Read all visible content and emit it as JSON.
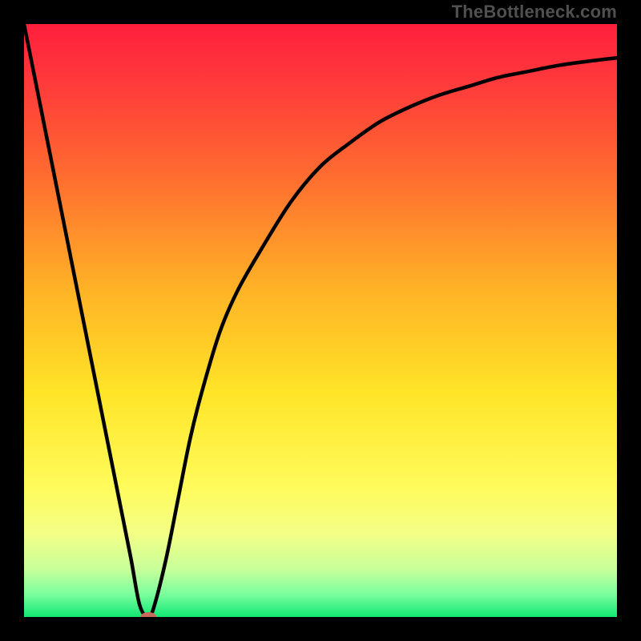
{
  "watermark": "TheBottleneck.com",
  "chart_data": {
    "type": "line",
    "title": "",
    "xlabel": "",
    "ylabel": "",
    "xlim": [
      0,
      100
    ],
    "ylim": [
      0,
      100
    ],
    "axes_visible": false,
    "grid": false,
    "background_gradient_stops": [
      {
        "pos": 0.0,
        "color": "#ff1f3d"
      },
      {
        "pos": 0.1,
        "color": "#ff3a3b"
      },
      {
        "pos": 0.25,
        "color": "#ff6a30"
      },
      {
        "pos": 0.45,
        "color": "#ffb326"
      },
      {
        "pos": 0.62,
        "color": "#ffe427"
      },
      {
        "pos": 0.78,
        "color": "#fffb5b"
      },
      {
        "pos": 0.86,
        "color": "#f3ff86"
      },
      {
        "pos": 0.92,
        "color": "#c7ff9a"
      },
      {
        "pos": 0.96,
        "color": "#7eff9e"
      },
      {
        "pos": 1.0,
        "color": "#11e875"
      }
    ],
    "series": [
      {
        "name": "bottleneck-curve",
        "x": [
          0,
          2,
          4,
          6,
          8,
          10,
          12,
          14,
          16,
          18,
          19.5,
          21,
          22,
          24,
          26,
          28,
          30,
          33,
          36,
          40,
          45,
          50,
          55,
          60,
          65,
          70,
          75,
          80,
          85,
          90,
          95,
          100
        ],
        "y": [
          100,
          90,
          80,
          70,
          60,
          50,
          40,
          30,
          20,
          10,
          2,
          0,
          2,
          10,
          20,
          30,
          38,
          48,
          55,
          62,
          70,
          76,
          80,
          83.5,
          86,
          88,
          89.5,
          91,
          92,
          93,
          93.7,
          94.3
        ]
      }
    ],
    "marker": {
      "name": "optimum-marker",
      "x": 21,
      "y": 0,
      "color": "#c96a5f",
      "rx": 10,
      "ry": 6
    }
  }
}
